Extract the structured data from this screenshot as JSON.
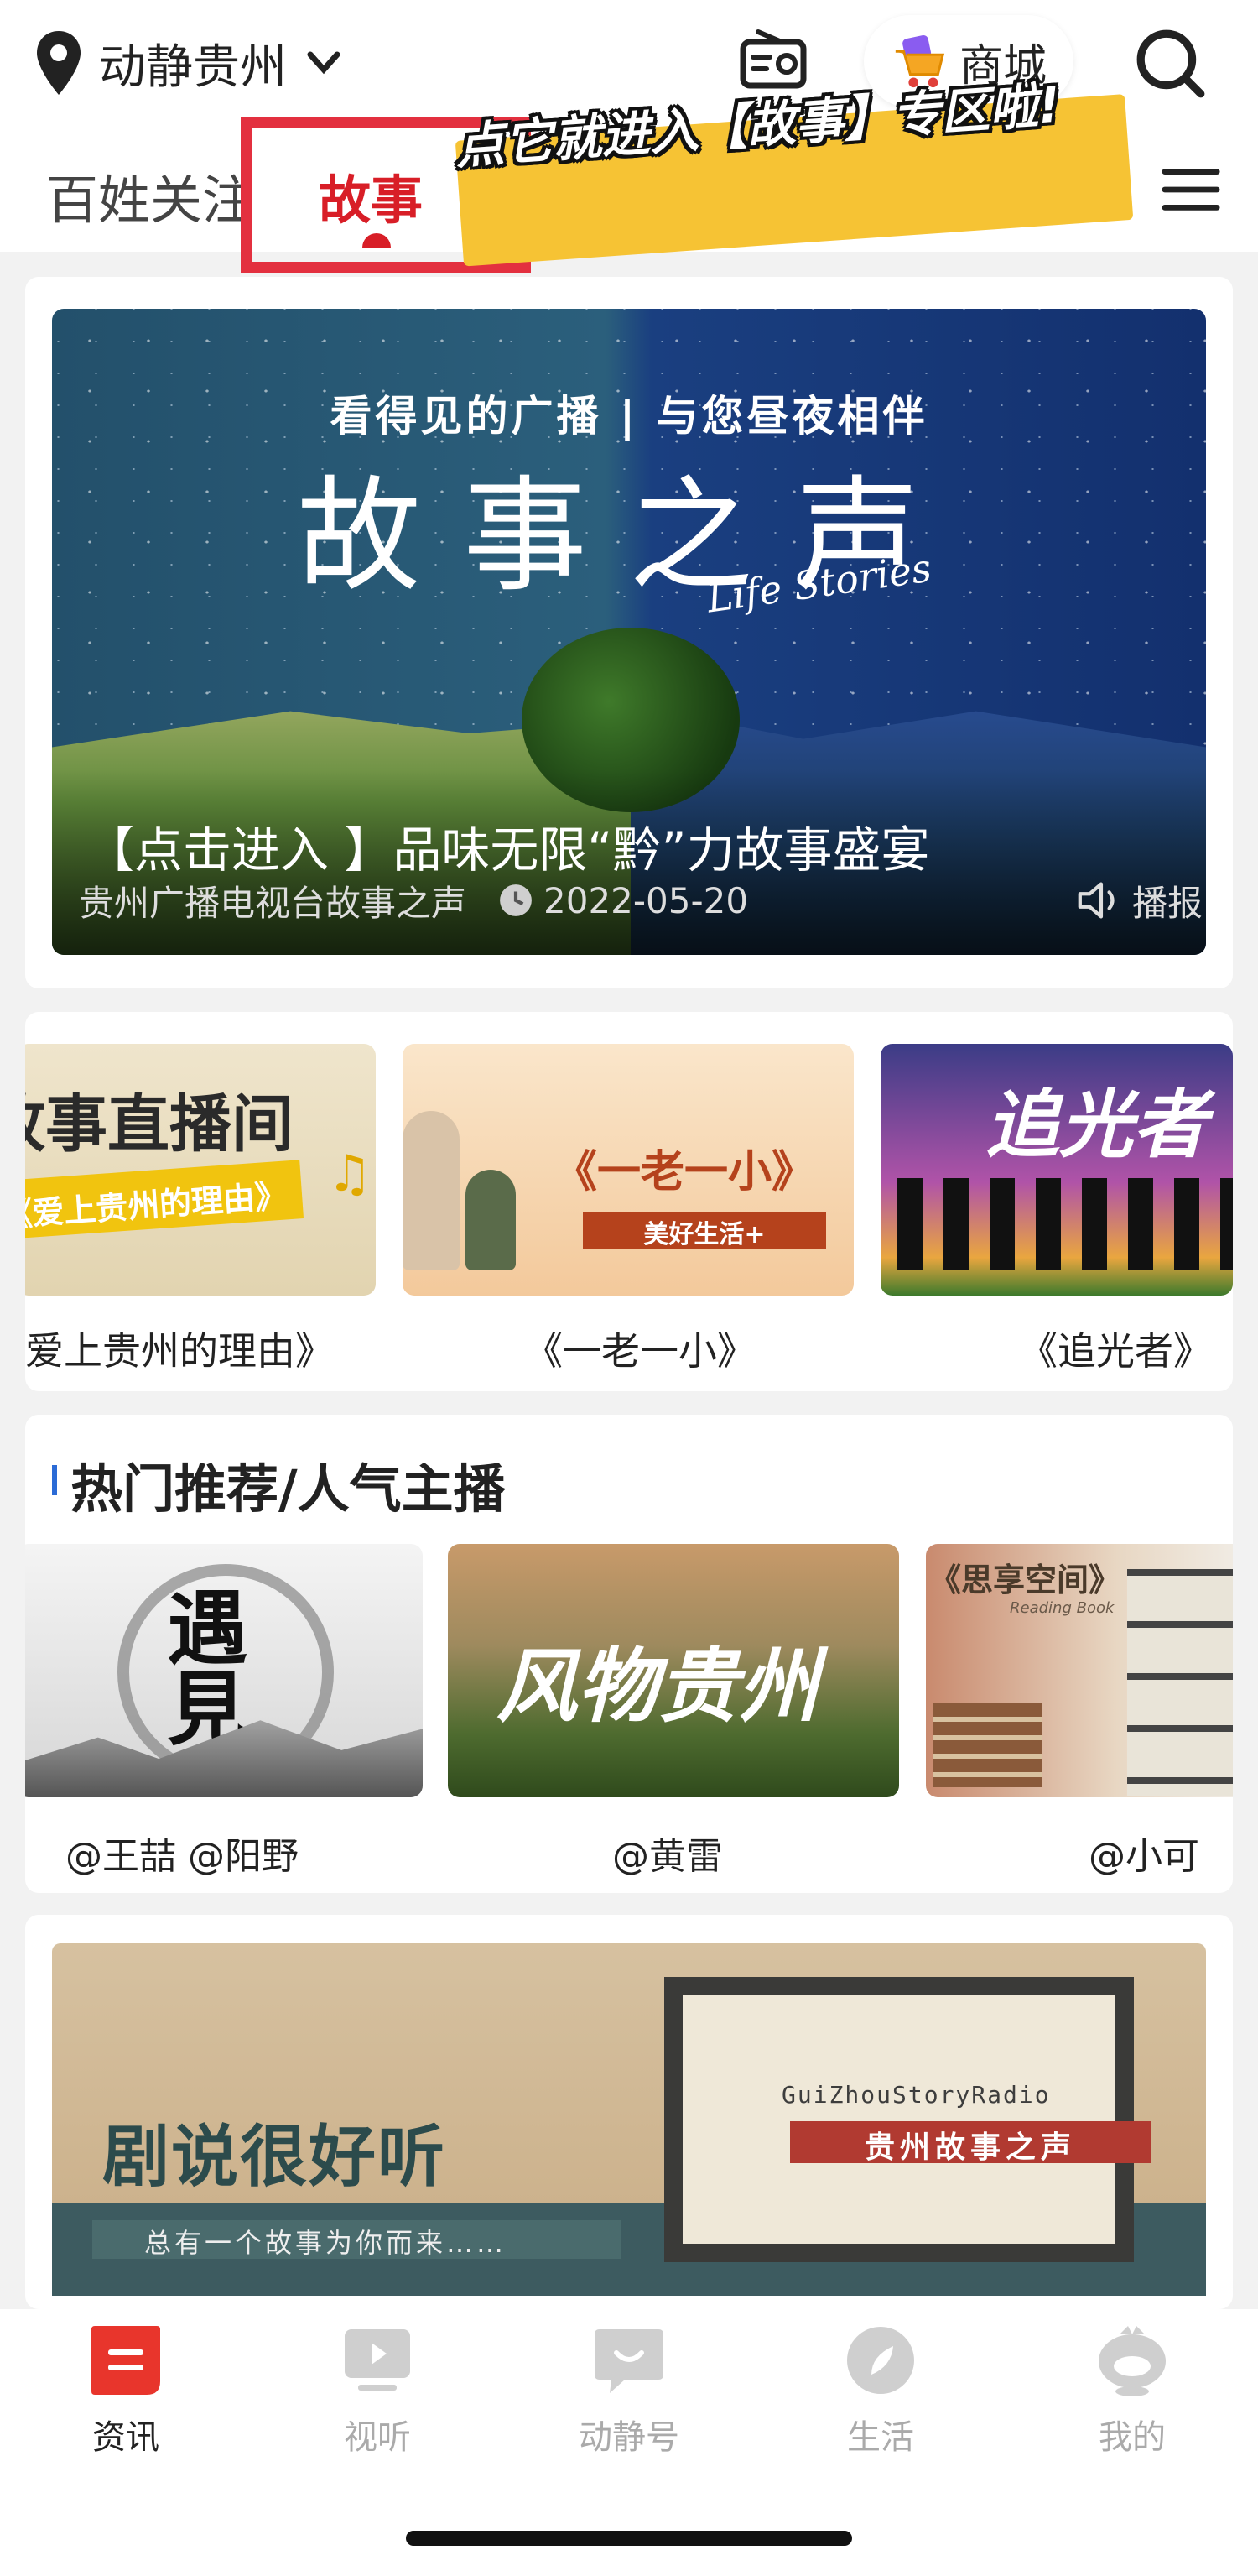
{
  "header": {
    "location": "动静贵州",
    "mall_label": "商城"
  },
  "tabs": {
    "baixing": "百姓关注",
    "gushi": "故事"
  },
  "tooltip": {
    "text": "点它就进入【故事】专区啦!"
  },
  "hero": {
    "image_subtitle": "看得见的广播 | 与您昼夜相伴",
    "image_title": "故事之声",
    "image_script": "Life Stories",
    "title": "【点击进入 】品味无限“黔”力故事盛宴",
    "source": "贵州广播电视台故事之声",
    "date": "2022-05-20",
    "broadcast_label": "播报"
  },
  "programs": [
    {
      "label": "爱上贵州的理由》",
      "art_title": "故事直播间",
      "art_tag": "《爱上贵州的理由》"
    },
    {
      "label": "《一老一小》",
      "art_title": "《一老一小》",
      "art_tag": "美好生活+"
    },
    {
      "label": "《追光者》",
      "art_title": "追光者"
    }
  ],
  "hot": {
    "title": "热门推荐/人气主播",
    "anchors": [
      {
        "label": "@王喆  @阳野",
        "art_text": "遇見"
      },
      {
        "label": "@黄雷",
        "art_text": "风物贵州"
      },
      {
        "label": "@小可",
        "art_text": "《思享空间》",
        "art_sub": "Reading Book"
      }
    ]
  },
  "banner": {
    "title": "剧说很好听",
    "subtitle": "总有一个故事为你而来……",
    "en": "GuiZhouStoryRadio",
    "red_label": "贵州故事之声"
  },
  "nav": {
    "items": [
      {
        "label": "资讯",
        "active": true
      },
      {
        "label": "视听"
      },
      {
        "label": "动静号"
      },
      {
        "label": "生活"
      },
      {
        "label": "我的"
      }
    ]
  },
  "colors": {
    "accent_red": "#d81e27",
    "highlight_red": "#e3303f",
    "tooltip_yellow": "#f6c334",
    "section_blue": "#2b6bd6"
  }
}
